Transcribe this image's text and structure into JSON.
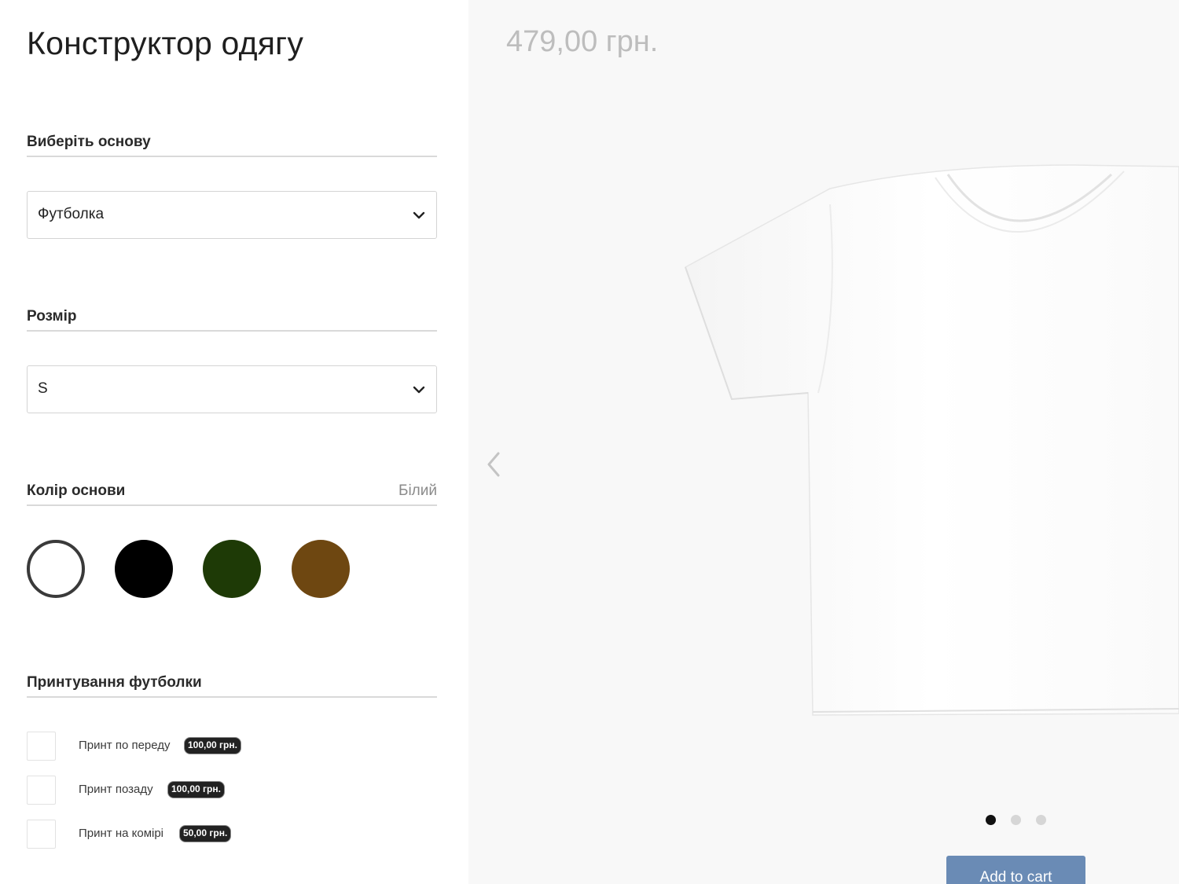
{
  "page_title": "Конструктор одягу",
  "base": {
    "label": "Виберіть основу",
    "selected": "Футболка"
  },
  "size": {
    "label": "Розмір",
    "selected": "S"
  },
  "color": {
    "label": "Колір основи",
    "selected_name": "Білий",
    "swatches": [
      {
        "color": "#ffffff",
        "selected": true
      },
      {
        "color": "#000000",
        "selected": false
      },
      {
        "color": "#1e3a06",
        "selected": false
      },
      {
        "color": "#6e4711",
        "selected": false
      }
    ]
  },
  "printing": {
    "label": "Принтування футболки",
    "options": [
      {
        "label": "Принт по переду",
        "price": "100,00 грн."
      },
      {
        "label": "Принт позаду",
        "price": "100,00 грн."
      },
      {
        "label": "Принт на комірі",
        "price": "50,00 грн."
      }
    ]
  },
  "preview": {
    "price": "479,00 грн.",
    "image": "white-tshirt-image",
    "slides_total": 3,
    "active_slide": 1
  },
  "add_to_cart_label": "Add to cart",
  "colors": {
    "button": "#6a8bb5",
    "preview_bg": "#f8f8f8"
  }
}
